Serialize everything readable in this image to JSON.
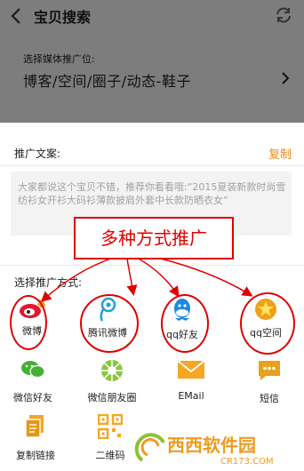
{
  "header": {
    "title": "宝贝搜索",
    "back_icon": "back-arrow-icon",
    "refresh_icon": "refresh-icon"
  },
  "media": {
    "label": "选择媒体推广位:",
    "value": "博客/空间/圈子/动态-鞋子"
  },
  "copy_section": {
    "label": "推广文案:",
    "copy_button": "复制",
    "text": "大家都说这个宝贝不错，推荐你看看哦:“2015夏装新款时尚雪纺衫女开衫大码衫薄款披肩外套中长款防晒衣女”"
  },
  "annotation": {
    "text": "多种方式推广",
    "color": "#e00000"
  },
  "share_section": {
    "label": "选择推广方式:",
    "items": [
      {
        "label": "微博",
        "icon": "weibo-icon"
      },
      {
        "label": "腾讯微博",
        "icon": "tencent-weibo-icon"
      },
      {
        "label": "qq好友",
        "icon": "qq-icon"
      },
      {
        "label": "qq空间",
        "icon": "qzone-icon"
      },
      {
        "label": "微信好友",
        "icon": "wechat-icon"
      },
      {
        "label": "微信朋友圈",
        "icon": "moments-icon"
      },
      {
        "label": "EMail",
        "icon": "email-icon"
      },
      {
        "label": "短信",
        "icon": "sms-icon"
      },
      {
        "label": "复制链接",
        "icon": "copy-link-icon"
      },
      {
        "label": "二维码",
        "icon": "qrcode-icon"
      }
    ]
  },
  "watermark": {
    "brand": "西西软件园",
    "site": "CR173.COM"
  },
  "colors": {
    "accent": "#f08a1a",
    "annotation_red": "#e00000"
  }
}
